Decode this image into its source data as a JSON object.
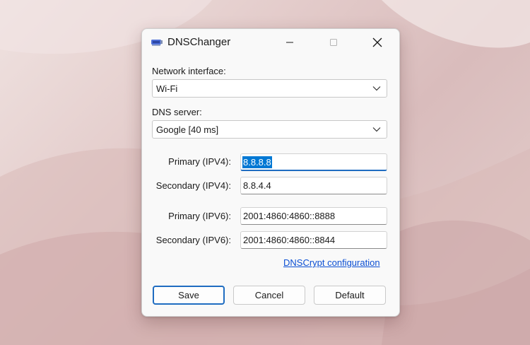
{
  "window": {
    "title": "DNSChanger"
  },
  "network_interface": {
    "label": "Network interface:",
    "selected": "Wi-Fi"
  },
  "dns_server": {
    "label": "DNS server:",
    "selected": "Google [40 ms]"
  },
  "fields": {
    "primary_ipv4": {
      "label": "Primary (IPV4):",
      "value": "8.8.8.8"
    },
    "secondary_ipv4": {
      "label": "Secondary (IPV4):",
      "value": "8.8.4.4"
    },
    "primary_ipv6": {
      "label": "Primary (IPV6):",
      "value": "2001:4860:4860::8888"
    },
    "secondary_ipv6": {
      "label": "Secondary (IPV6):",
      "value": "2001:4860:4860::8844"
    }
  },
  "links": {
    "dnscrypt": "DNSCrypt configuration"
  },
  "buttons": {
    "save": "Save",
    "cancel": "Cancel",
    "default": "Default"
  },
  "colors": {
    "accent": "#1f6cc1",
    "selection": "#0078d4",
    "link": "#0b4fd3"
  },
  "icons": {
    "app": "network-adapter-icon",
    "minimize": "minimize-icon",
    "maximize": "maximize-icon",
    "close": "close-icon",
    "dropdown": "chevron-down-icon"
  }
}
